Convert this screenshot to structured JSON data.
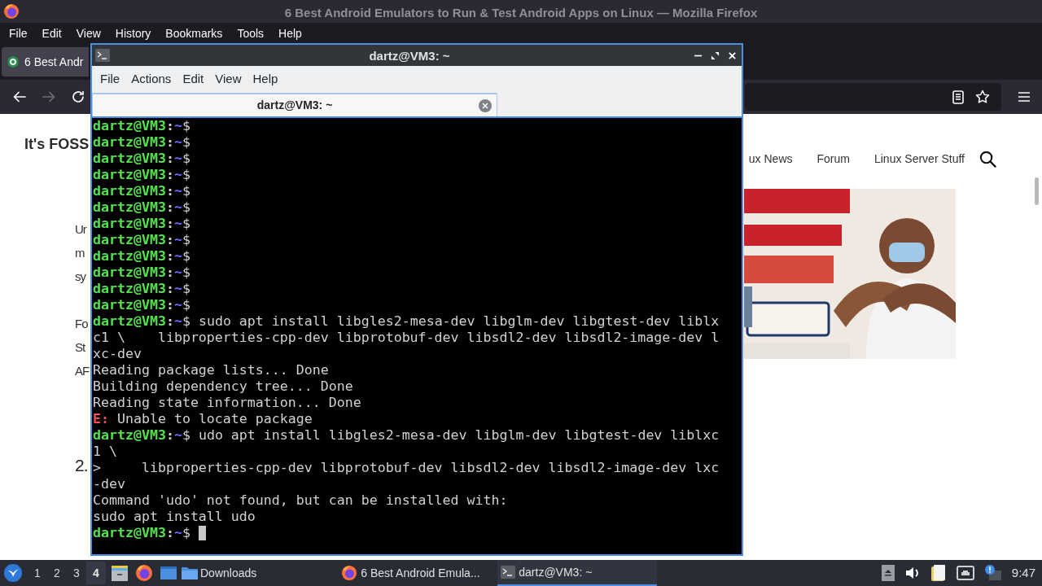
{
  "browser": {
    "window_title": "6 Best Android Emulators to Run & Test Android Apps on Linux — Mozilla Firefox",
    "menu": [
      "File",
      "Edit",
      "View",
      "History",
      "Bookmarks",
      "Tools",
      "Help"
    ],
    "tabs": [
      {
        "label": "6 Best Andr",
        "selected": true
      }
    ],
    "nav_buttons": [
      {
        "kind": "back",
        "disabled": false
      },
      {
        "kind": "forward",
        "disabled": true
      },
      {
        "kind": "reload",
        "disabled": false
      }
    ],
    "page": {
      "site_title": "It's FOSS",
      "nav_links": [
        "ux News",
        "Forum",
        "Linux Server Stuff"
      ],
      "paragraphs": [
        {
          "lines": [
            "Ur",
            "m",
            "sy"
          ]
        },
        {
          "lines": [
            "Fo",
            "St",
            "AF"
          ]
        }
      ],
      "heading_fragment": "2.",
      "ad": {
        "kind": "picture"
      }
    }
  },
  "terminal": {
    "title": "dartz@VM3: ~",
    "menu": [
      "File",
      "Actions",
      "Edit",
      "View",
      "Help"
    ],
    "tabs": [
      {
        "label": "dartz@VM3: ~",
        "selected": true
      }
    ],
    "lines": [
      {
        "kind": "prompt",
        "user": "dartz@VM3",
        "sep": ":",
        "path": "~",
        "sigil": "$",
        "cursor": false
      },
      {
        "kind": "prompt",
        "user": "dartz@VM3",
        "sep": ":",
        "path": "~",
        "sigil": "$",
        "cursor": false
      },
      {
        "kind": "prompt",
        "user": "dartz@VM3",
        "sep": ":",
        "path": "~",
        "sigil": "$",
        "cursor": false
      },
      {
        "kind": "prompt",
        "user": "dartz@VM3",
        "sep": ":",
        "path": "~",
        "sigil": "$",
        "cursor": false
      },
      {
        "kind": "prompt",
        "user": "dartz@VM3",
        "sep": ":",
        "path": "~",
        "sigil": "$",
        "cursor": false
      },
      {
        "kind": "prompt",
        "user": "dartz@VM3",
        "sep": ":",
        "path": "~",
        "sigil": "$",
        "cursor": false
      },
      {
        "kind": "prompt",
        "user": "dartz@VM3",
        "sep": ":",
        "path": "~",
        "sigil": "$",
        "cursor": false
      },
      {
        "kind": "prompt",
        "user": "dartz@VM3",
        "sep": ":",
        "path": "~",
        "sigil": "$",
        "cursor": false
      },
      {
        "kind": "prompt",
        "user": "dartz@VM3",
        "sep": ":",
        "path": "~",
        "sigil": "$",
        "cursor": false
      },
      {
        "kind": "prompt",
        "user": "dartz@VM3",
        "sep": ":",
        "path": "~",
        "sigil": "$",
        "cursor": false
      },
      {
        "kind": "prompt",
        "user": "dartz@VM3",
        "sep": ":",
        "path": "~",
        "sigil": "$",
        "cursor": false
      },
      {
        "kind": "prompt",
        "user": "dartz@VM3",
        "sep": ":",
        "path": "~",
        "sigil": "$",
        "cursor": false
      },
      {
        "kind": "prompt",
        "user": "dartz@VM3",
        "sep": ":",
        "path": "~",
        "sigil": "$",
        "command": " sudo apt install libgles2-mesa-dev libglm-dev libgtest-dev liblx",
        "cursor": false
      },
      {
        "kind": "output",
        "text": "c1 \\    libproperties-cpp-dev libprotobuf-dev libsdl2-dev libsdl2-image-dev l"
      },
      {
        "kind": "output",
        "text": "xc-dev"
      },
      {
        "kind": "output",
        "text": "Reading package lists... Done"
      },
      {
        "kind": "output",
        "text": "Building dependency tree... Done"
      },
      {
        "kind": "output",
        "text": "Reading state information... Done"
      },
      {
        "kind": "error",
        "label": "E:",
        "text": " Unable to locate package"
      },
      {
        "kind": "prompt",
        "user": "dartz@VM3",
        "sep": ":",
        "path": "~",
        "sigil": "$",
        "command": " udo apt install libgles2-mesa-dev libglm-dev libgtest-dev liblxc",
        "cursor": false
      },
      {
        "kind": "output",
        "text": "1 \\"
      },
      {
        "kind": "output",
        "text": ">     libproperties-cpp-dev libprotobuf-dev libsdl2-dev libsdl2-image-dev lxc"
      },
      {
        "kind": "output",
        "text": "-dev"
      },
      {
        "kind": "output",
        "text": "Command 'udo' not found, but can be installed with:"
      },
      {
        "kind": "output",
        "text": "sudo apt install udo"
      },
      {
        "kind": "prompt",
        "user": "dartz@VM3",
        "sep": ":",
        "path": "~",
        "sigil": "$",
        "cursor": true
      }
    ]
  },
  "taskbar": {
    "workspaces": [
      {
        "label": "1",
        "selected": false
      },
      {
        "label": "2",
        "selected": false
      },
      {
        "label": "3",
        "selected": false
      },
      {
        "label": "4",
        "selected": true
      }
    ],
    "folder_launcher": "Downloads",
    "tasks": [
      {
        "kind": "browser",
        "label": "6 Best Android Emula...",
        "selected": false
      },
      {
        "kind": "terminal",
        "label": "dartz@VM3: ~",
        "selected": true
      }
    ],
    "clock": "9:47"
  }
}
